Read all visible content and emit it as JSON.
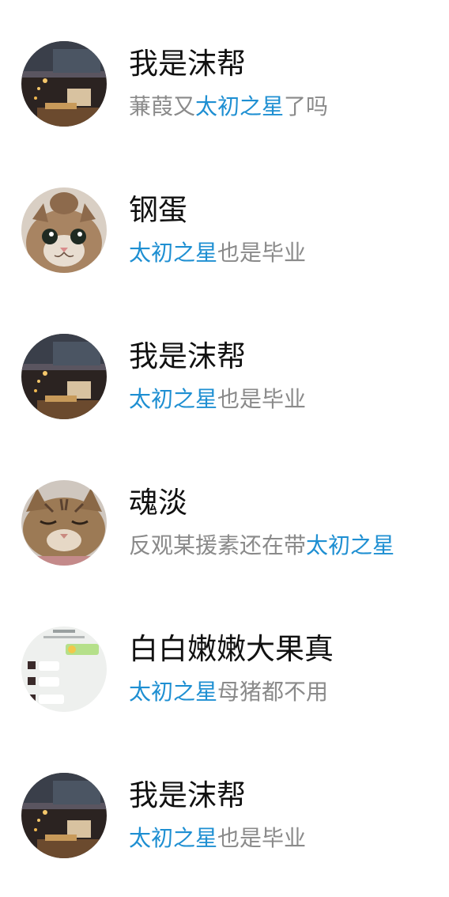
{
  "colors": {
    "name": "#111111",
    "snippet": "#8a8a8a",
    "highlight": "#1e8fd2",
    "background": "#ffffff"
  },
  "items": [
    {
      "avatar": "desk-lamp-photo",
      "name": "我是沫帮",
      "snippet_before": "蒹葭又",
      "highlight": "太初之星",
      "snippet_after": "了吗"
    },
    {
      "avatar": "kitten-photo",
      "name": "钢蛋",
      "snippet_before": "",
      "highlight": "太初之星",
      "snippet_after": "也是毕业"
    },
    {
      "avatar": "desk-lamp-photo",
      "name": "我是沫帮",
      "snippet_before": "",
      "highlight": "太初之星",
      "snippet_after": "也是毕业"
    },
    {
      "avatar": "sleeping-cat-photo",
      "name": "魂淡",
      "snippet_before": "反观某援素还在带",
      "highlight": "太初之星",
      "snippet_after": ""
    },
    {
      "avatar": "chat-screenshot-photo",
      "name": "白白嫩嫩大果真",
      "snippet_before": "",
      "highlight": "太初之星",
      "snippet_after": "母猪都不用"
    },
    {
      "avatar": "desk-lamp-photo",
      "name": "我是沫帮",
      "snippet_before": "",
      "highlight": "太初之星",
      "snippet_after": "也是毕业"
    }
  ]
}
